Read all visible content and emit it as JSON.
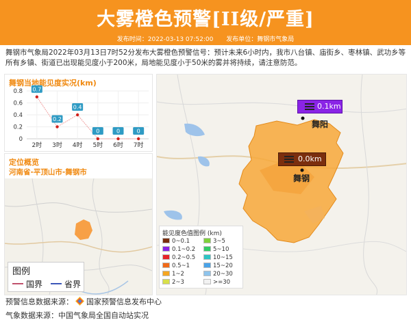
{
  "header": {
    "title": "大雾橙色预警[II级/严重]",
    "publish_time": "发布时间：2022-03-13 07:52:00",
    "publisher": "发布单位：舞钢市气象局"
  },
  "notice": "舞钢市气象局2022年03月13日7时52分发布大雾橙色预警信号：预计未来6小时内，我市八台镇、庙街乡、枣林镇、武功乡等所有乡镇、街道已出现能见度小于200米，局地能见度小于50米的雾并将持续，请注意防范。",
  "visibility_panel": {
    "title": "舞钢当地能见度实况(km)",
    "y_ticks": [
      "0.8",
      "0.7",
      "0.6",
      "0.5",
      "0.4",
      "0.3",
      "0.2",
      "0.1",
      "0"
    ]
  },
  "chart_data": {
    "type": "line",
    "title": "舞钢当地能见度实况(km)",
    "categories": [
      "2时",
      "3时",
      "4时",
      "5时",
      "6时",
      "7时"
    ],
    "values": [
      0.7,
      0.2,
      0.4,
      0,
      0,
      0
    ],
    "labels": [
      "0.7",
      "0.2",
      "0.4",
      "0",
      "0",
      "0"
    ],
    "ylim": [
      0,
      0.8
    ],
    "grid": true
  },
  "location_panel": {
    "title": "定位概览",
    "path": "河南省-平顶山市-舞钢市"
  },
  "small_legend": {
    "title": "图例",
    "items": [
      {
        "label": "国界",
        "color": "#c0506c"
      },
      {
        "label": "省界",
        "color": "#3a56b8"
      }
    ]
  },
  "map": {
    "stations": [
      {
        "name": "舞阳",
        "value": "0.1km",
        "color": "#8a24e6"
      },
      {
        "name": "舞钢",
        "value": "0.0km",
        "color": "#7b2e0e"
      }
    ]
  },
  "legend": {
    "title": "能见度色值图例 (km)",
    "items": [
      {
        "label": "0~0.1",
        "color": "#7b2e0e"
      },
      {
        "label": "0.1~0.2",
        "color": "#8a24e6"
      },
      {
        "label": "0.2~0.5",
        "color": "#e8232a"
      },
      {
        "label": "0.5~1",
        "color": "#f06a1a"
      },
      {
        "label": "1~2",
        "color": "#f5a623"
      },
      {
        "label": "2~3",
        "color": "#d8e04a"
      },
      {
        "label": "3~5",
        "color": "#7fd13b"
      },
      {
        "label": "5~10",
        "color": "#33cc66"
      },
      {
        "label": "10~15",
        "color": "#2ec4c4"
      },
      {
        "label": "15~20",
        "color": "#4aa3e8"
      },
      {
        "label": "20~30",
        "color": "#8ec4ec"
      },
      {
        "label": ">=30",
        "color": "#f2f2f2"
      }
    ]
  },
  "footer": {
    "line1_prefix": "预警信息数据来源：",
    "line1_source": "国家预警信息发布中心",
    "line2": "气象数据来源：中国气象局全国自动站实况"
  }
}
